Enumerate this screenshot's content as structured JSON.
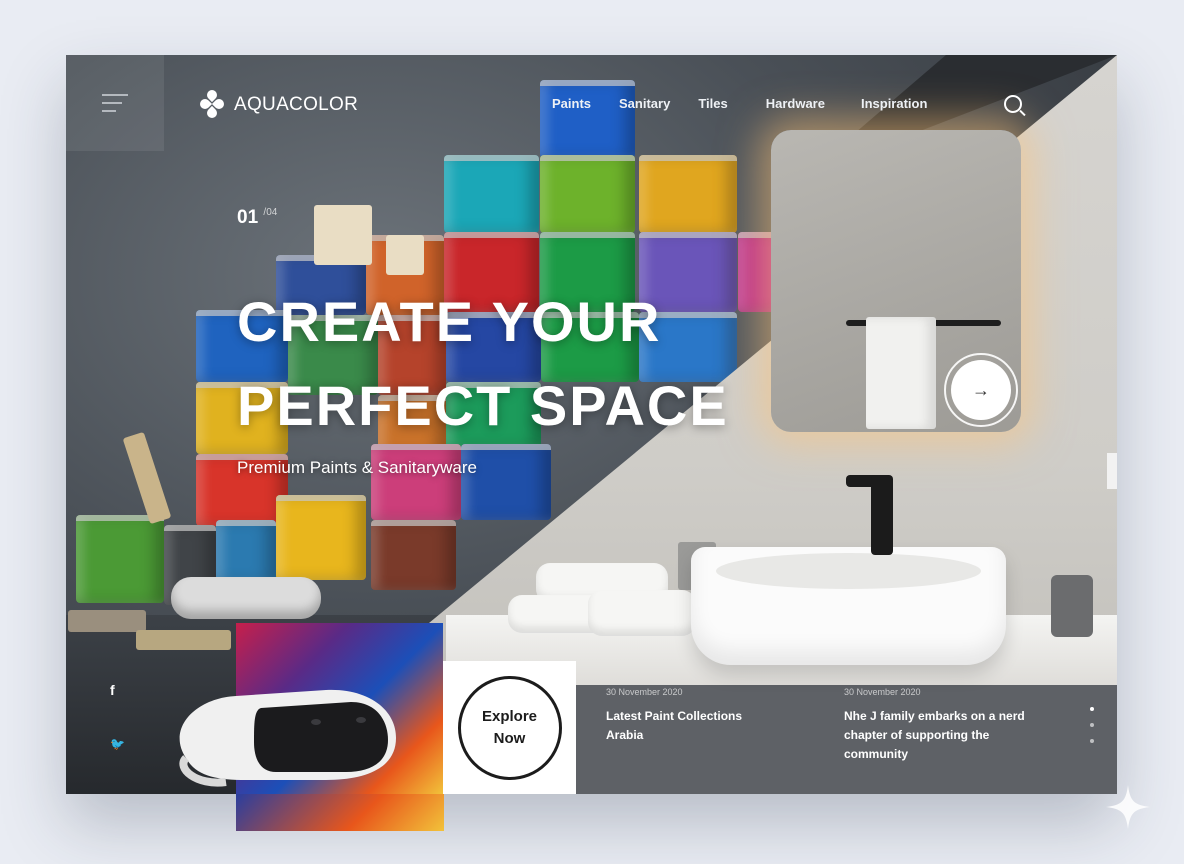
{
  "brand": {
    "name": "AQUACOLOR"
  },
  "nav": {
    "items": [
      "Paints",
      "Sanitary",
      "Tiles",
      "Hardware",
      "Inspiration"
    ]
  },
  "hero": {
    "slide_current": "01",
    "slide_total": "/04",
    "title_line1": "CREATE YOUR",
    "title_line2": "PERFECT SPACE",
    "subtitle": "Premium Paints & Sanitaryware",
    "next_arrow": "→"
  },
  "social": {
    "facebook": "f",
    "twitter": "🐦"
  },
  "explore": {
    "line1": "Explore",
    "line2": "Now"
  },
  "news": [
    {
      "date": "30 November 2020",
      "title_line1": "Latest Paint Collections",
      "title_line2": "Arabia"
    },
    {
      "date": "30 November 2020",
      "title_line1": "Nhe J family embarks on a nerd",
      "title_line2": "chapter of supporting the",
      "title_line3": "community"
    }
  ],
  "icons": {
    "menu": "menu-icon",
    "search": "search-icon",
    "next": "arrow-right-icon",
    "facebook": "facebook-icon",
    "twitter": "twitter-icon",
    "sparkle": "sparkle-icon"
  },
  "colors": {
    "background": "#e9ecf3",
    "text": "#ffffff",
    "explore_border": "#1c1c1c"
  }
}
